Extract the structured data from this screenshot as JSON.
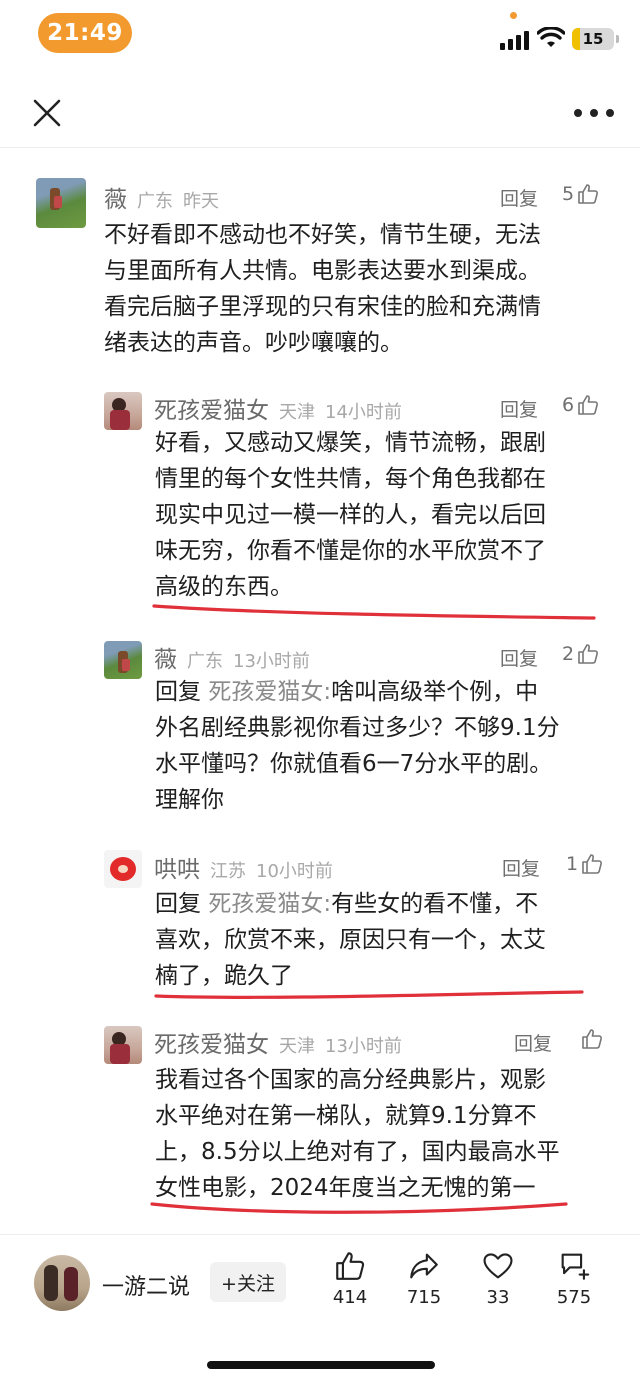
{
  "status_bar": {
    "time": "21:49",
    "battery": "15",
    "battery_level_percent": 15,
    "accent_color": "#f29a2e"
  },
  "nav": {
    "close_icon": "close-icon",
    "more_icon": "more-icon"
  },
  "comments": [
    {
      "name": "薇",
      "location": "广东",
      "time": "昨天",
      "reply_label": "回复",
      "likes": "5",
      "text_lines": [
        "不好看即不感动也不好笑，情节生硬，无法",
        "与里面所有人共情。电影表达要水到渠成。",
        "看完后脑子里浮现的只有宋佳的脸和充满情",
        "绪表达的声音。吵吵嚷嚷的。"
      ]
    },
    {
      "name": "死孩爱猫女",
      "location": "天津",
      "time": "14小时前",
      "reply_label": "回复",
      "likes": "6",
      "text_lines": [
        "好看，又感动又爆笑，情节流畅，跟剧",
        "情里的每个女性共情，每个角色我都在",
        "现实中见过一模一样的人，看完以后回",
        "味无穷，你看不懂是你的水平欣赏不了",
        "高级的东西。"
      ]
    },
    {
      "name": "薇",
      "location": "广东",
      "time": "13小时前",
      "reply_label": "回复",
      "likes": "2",
      "reply_prefix": "回复",
      "reply_to": "死孩爱猫女:",
      "text_first": "啥叫高级举个例，中",
      "text_lines": [
        "外名剧经典影视你看过多少？不够9.1分",
        "水平懂吗？你就值看6一7分水平的剧。",
        "理解你"
      ]
    },
    {
      "name": "哄哄",
      "location": "江苏",
      "time": "10小时前",
      "reply_label": "回复",
      "likes": "1",
      "reply_prefix": "回复",
      "reply_to": "死孩爱猫女:",
      "text_first": "有些女的看不懂，不",
      "text_lines": [
        "喜欢，欣赏不来，原因只有一个，太艾",
        "楠了，跪久了"
      ]
    },
    {
      "name": "死孩爱猫女",
      "location": "天津",
      "time": "13小时前",
      "reply_label": "回复",
      "likes": "",
      "text_lines": [
        "我看过各个国家的高分经典影片，观影",
        "水平绝对在第一梯队，就算9.1分算不",
        "上，8.5分以上绝对有了，国内最高水平",
        "女性电影，2024年度当之无愧的第一"
      ]
    }
  ],
  "bottom_bar": {
    "author": "一游二说",
    "follow_label": "+关注",
    "actions": [
      {
        "icon": "like-icon",
        "count": "414"
      },
      {
        "icon": "share-icon",
        "count": "715"
      },
      {
        "icon": "heart-icon",
        "count": "33"
      },
      {
        "icon": "comment-icon",
        "count": "575"
      }
    ]
  },
  "annotation_color": "#e0303a"
}
